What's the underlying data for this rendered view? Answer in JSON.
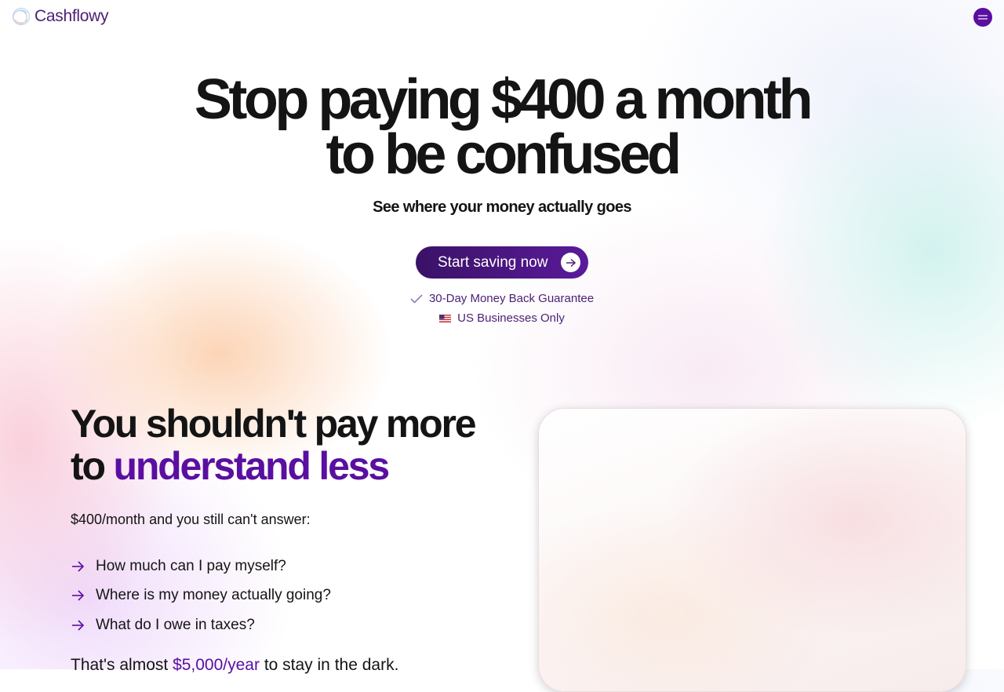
{
  "brand": {
    "name": "Cashflowy"
  },
  "header": {
    "menu_icon": "hamburger-icon"
  },
  "hero": {
    "title_line1": "Stop paying $400 a month",
    "title_line2": "to be confused",
    "subtitle": "See where your money actually goes",
    "cta_label": "Start saving now",
    "guarantee": "30-Day Money Back Guarantee",
    "region": "US Businesses Only"
  },
  "section": {
    "title_part1": "You shouldn't pay more",
    "title_part2": "to ",
    "title_accent": "understand less",
    "intro": "$400/month and you still can't answer:",
    "questions": [
      "How much can I pay myself?",
      "Where is my money actually going?",
      "What do I owe in taxes?"
    ],
    "cost_prefix": "That's almost ",
    "cost_amount": "$5,000/year",
    "cost_suffix": " to stay in the dark."
  },
  "colors": {
    "brand_purple": "#5a0fa0",
    "ink": "#141414",
    "brand_text": "#4a1f75"
  }
}
